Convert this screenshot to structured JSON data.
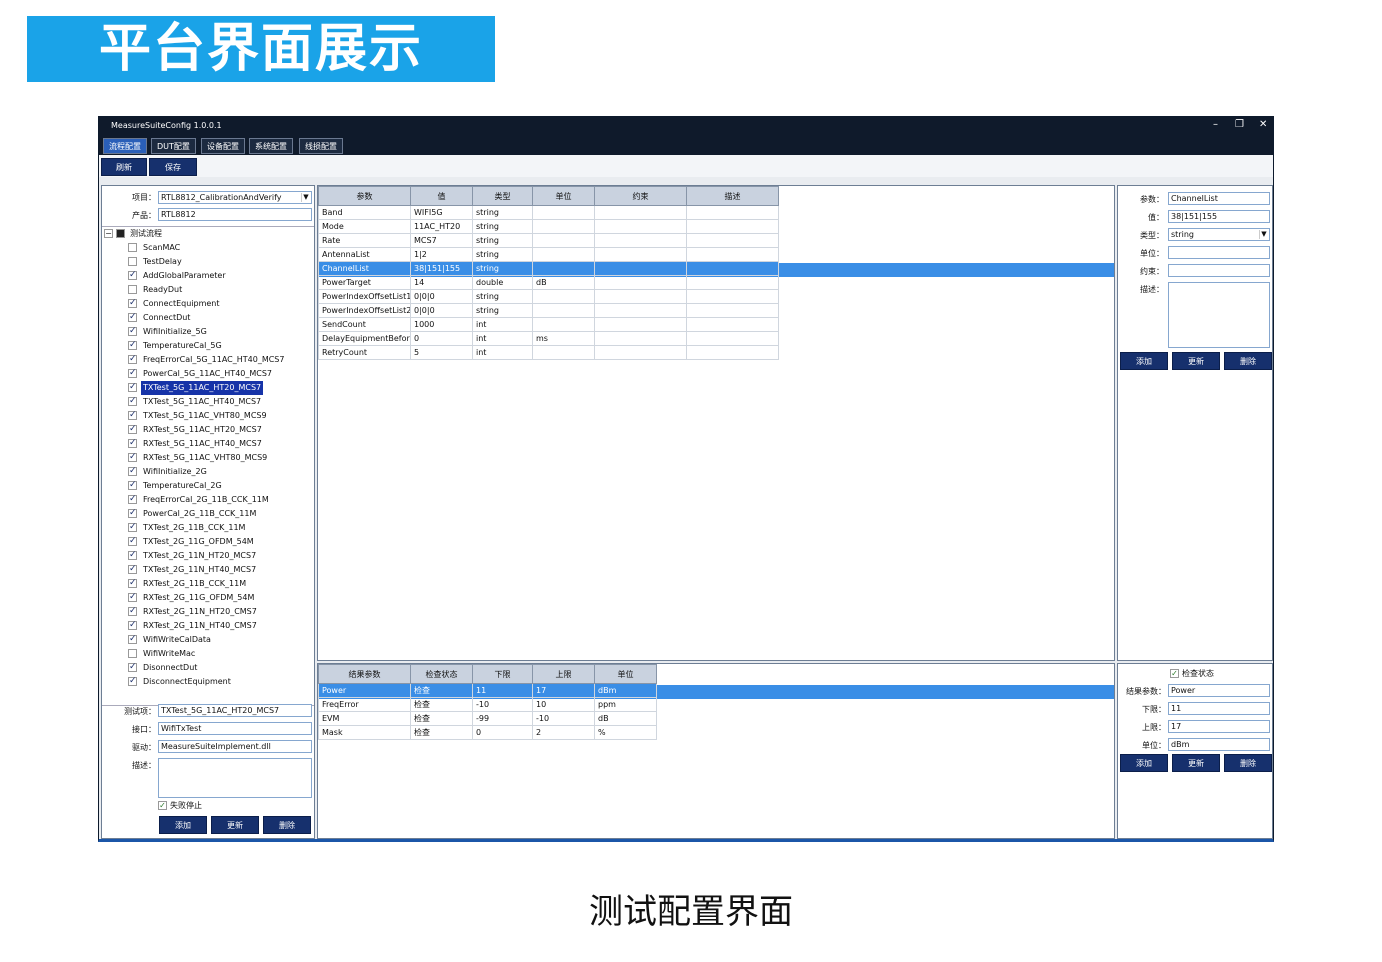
{
  "banner_title": "平台界面展示",
  "caption": "测试配置界面",
  "window": {
    "title": "MeasureSuiteConfig 1.0.0.1",
    "minimize": "–",
    "restore": "❐",
    "close": "✕"
  },
  "menu_tabs": [
    "流程配置",
    "DUT配置",
    "设备配置",
    "系统配置",
    "线损配置"
  ],
  "toolbar": {
    "refresh": "刷新",
    "save": "保存"
  },
  "left": {
    "project_label": "项目：",
    "project_value": "RTL8812_CalibrationAndVerify",
    "product_label": "产品：",
    "product_value": "RTL8812",
    "tree_root": "测试流程",
    "tree": [
      {
        "label": "ScanMAC",
        "checked": false
      },
      {
        "label": "TestDelay",
        "checked": false
      },
      {
        "label": "AddGlobalParameter",
        "checked": true
      },
      {
        "label": "ReadyDut",
        "checked": false
      },
      {
        "label": "ConnectEquipment",
        "checked": true
      },
      {
        "label": "ConnectDut",
        "checked": true
      },
      {
        "label": "WifiInitialize_5G",
        "checked": true
      },
      {
        "label": "TemperatureCal_5G",
        "checked": true
      },
      {
        "label": "FreqErrorCal_5G_11AC_HT40_MCS7",
        "checked": true
      },
      {
        "label": "PowerCal_5G_11AC_HT40_MCS7",
        "checked": true
      },
      {
        "label": "TXTest_5G_11AC_HT20_MCS7",
        "checked": true,
        "selected": true
      },
      {
        "label": "TXTest_5G_11AC_HT40_MCS7",
        "checked": true
      },
      {
        "label": "TXTest_5G_11AC_VHT80_MCS9",
        "checked": true
      },
      {
        "label": "RXTest_5G_11AC_HT20_MCS7",
        "checked": true
      },
      {
        "label": "RXTest_5G_11AC_HT40_MCS7",
        "checked": true
      },
      {
        "label": "RXTest_5G_11AC_VHT80_MCS9",
        "checked": true
      },
      {
        "label": "WifiInitialize_2G",
        "checked": true
      },
      {
        "label": "TemperatureCal_2G",
        "checked": true
      },
      {
        "label": "FreqErrorCal_2G_11B_CCK_11M",
        "checked": true
      },
      {
        "label": "PowerCal_2G_11B_CCK_11M",
        "checked": true
      },
      {
        "label": "TXTest_2G_11B_CCK_11M",
        "checked": true
      },
      {
        "label": "TXTest_2G_11G_OFDM_54M",
        "checked": true
      },
      {
        "label": "TXTest_2G_11N_HT20_MCS7",
        "checked": true
      },
      {
        "label": "TXTest_2G_11N_HT40_MCS7",
        "checked": true
      },
      {
        "label": "RXTest_2G_11B_CCK_11M",
        "checked": true
      },
      {
        "label": "RXTest_2G_11G_OFDM_54M",
        "checked": true
      },
      {
        "label": "RXTest_2G_11N_HT20_CMS7",
        "checked": true
      },
      {
        "label": "RXTest_2G_11N_HT40_CMS7",
        "checked": true
      },
      {
        "label": "WifiWriteCalData",
        "checked": true
      },
      {
        "label": "WifiWriteMac",
        "checked": false
      },
      {
        "label": "DisonnectDut",
        "checked": true
      },
      {
        "label": "DisconnectEquipment",
        "checked": true
      }
    ],
    "testitem_label": "测试项：",
    "testitem_value": "TXTest_5G_11AC_HT20_MCS7",
    "interface_label": "接口：",
    "interface_value": "WifiTxTest",
    "driver_label": "驱动：",
    "driver_value": "MeasureSuiteImplement.dll",
    "desc_label": "描述：",
    "stop_on_fail": "失败停止",
    "add": "添加",
    "update": "更新",
    "delete": "删除"
  },
  "params_table": {
    "headers": [
      "参数",
      "值",
      "类型",
      "单位",
      "约束",
      "描述"
    ],
    "rows": [
      [
        "Band",
        "WIFI5G",
        "string",
        "",
        "",
        ""
      ],
      [
        "Mode",
        "11AC_HT20",
        "string",
        "",
        "",
        ""
      ],
      [
        "Rate",
        "MCS7",
        "string",
        "",
        "",
        ""
      ],
      [
        "AntennaList",
        "1|2",
        "string",
        "",
        "",
        ""
      ],
      [
        "ChannelList",
        "38|151|155",
        "string",
        "",
        "",
        ""
      ],
      [
        "PowerTarget",
        "14",
        "double",
        "dB",
        "",
        ""
      ],
      [
        "PowerIndexOffsetList1",
        "0|0|0",
        "string",
        "",
        "",
        ""
      ],
      [
        "PowerIndexOffsetList2",
        "0|0|0",
        "string",
        "",
        "",
        ""
      ],
      [
        "SendCount",
        "1000",
        "int",
        "",
        "",
        ""
      ],
      [
        "DelayEquipmentBefore",
        "0",
        "int",
        "ms",
        "",
        ""
      ],
      [
        "RetryCount",
        "5",
        "int",
        "",
        "",
        ""
      ]
    ],
    "selected_row": 4
  },
  "results_table": {
    "headers": [
      "结果参数",
      "检查状态",
      "下限",
      "上限",
      "单位"
    ],
    "rows": [
      [
        "Power",
        "检查",
        "11",
        "17",
        "dBm"
      ],
      [
        "FreqError",
        "检查",
        "-10",
        "10",
        "ppm"
      ],
      [
        "EVM",
        "检查",
        "-99",
        "-10",
        "dB"
      ],
      [
        "Mask",
        "检查",
        "0",
        "2",
        "%"
      ]
    ],
    "selected_row": 0
  },
  "right_top": {
    "param_label": "参数：",
    "param_value": "ChannelList",
    "value_label": "值：",
    "value_value": "38|151|155",
    "type_label": "类型：",
    "type_value": "string",
    "unit_label": "单位：",
    "unit_value": "",
    "constraint_label": "约束：",
    "constraint_value": "",
    "desc_label": "描述：",
    "add": "添加",
    "update": "更新",
    "delete": "删除"
  },
  "right_bottom": {
    "check_label": "检查状态",
    "result_label": "结果参数：",
    "result_value": "Power",
    "lower_label": "下限：",
    "lower_value": "11",
    "upper_label": "上限：",
    "upper_value": "17",
    "unit_label": "单位：",
    "unit_value": "dBm",
    "add": "添加",
    "update": "更新",
    "delete": "删除"
  },
  "colors": {
    "banner": "#1aa3e8",
    "titlebar": "#0f1a2b",
    "button": "#16306d",
    "selection": "#3a8ee6"
  }
}
